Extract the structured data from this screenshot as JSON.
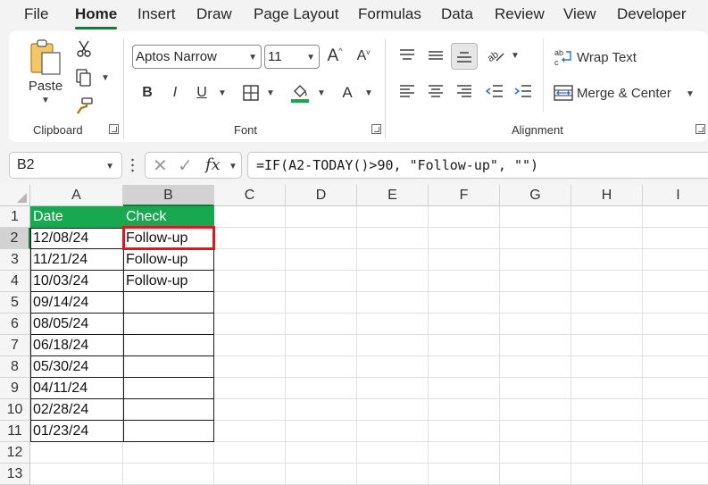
{
  "menu": [
    "File",
    "Home",
    "Insert",
    "Draw",
    "Page Layout",
    "Formulas",
    "Data",
    "Review",
    "View",
    "Developer"
  ],
  "active_menu": "Home",
  "ribbon": {
    "clipboard": {
      "paste_label": "Paste",
      "group_label": "Clipboard"
    },
    "font": {
      "font_name": "Aptos Narrow",
      "font_size": "11",
      "bold": "B",
      "italic": "I",
      "underline": "U",
      "grow": "A",
      "shrink": "A",
      "font_color": "A",
      "group_label": "Font"
    },
    "alignment": {
      "wrap_text": "Wrap Text",
      "merge_center": "Merge & Center",
      "group_label": "Alignment"
    }
  },
  "formula_bar": {
    "name_box": "B2",
    "fx": "fx",
    "formula": "=IF(A2-TODAY()>90, \"Follow-up\", \"\")"
  },
  "columns": [
    "A",
    "B",
    "C",
    "D",
    "E",
    "F",
    "G",
    "H",
    "I"
  ],
  "rows": [
    "1",
    "2",
    "3",
    "4",
    "5",
    "6",
    "7",
    "8",
    "9",
    "10",
    "11",
    "12",
    "13"
  ],
  "table": {
    "headers": [
      "Date",
      "Check"
    ],
    "rows": [
      [
        "12/08/24",
        "Follow-up"
      ],
      [
        "11/21/24",
        "Follow-up"
      ],
      [
        "10/03/24",
        "Follow-up"
      ],
      [
        "09/14/24",
        ""
      ],
      [
        "08/05/24",
        ""
      ],
      [
        "06/18/24",
        ""
      ],
      [
        "05/30/24",
        ""
      ],
      [
        "04/11/24",
        ""
      ],
      [
        "02/28/24",
        ""
      ],
      [
        "01/23/24",
        ""
      ]
    ]
  },
  "selected_cell": "B2",
  "colors": {
    "accent": "#117a3d",
    "header_fill": "#18a84f",
    "selection": "#e0151f",
    "font_color_bar": "#18a84f"
  }
}
